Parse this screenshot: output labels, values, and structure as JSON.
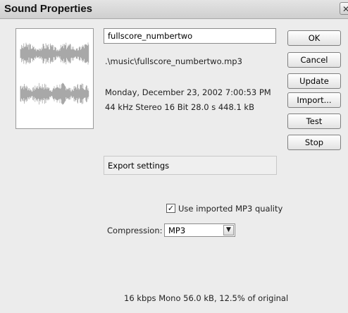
{
  "window": {
    "title": "Sound Properties",
    "close_glyph": "✕"
  },
  "sound": {
    "name": "fullscore_numbertwo",
    "path": ".\\music\\fullscore_numbertwo.mp3",
    "date": "Monday, December 23, 2002  7:00:53 PM",
    "format_info": "44 kHz Stereo 16 Bit 28.0 s 448.1 kB"
  },
  "buttons": {
    "ok": "OK",
    "cancel": "Cancel",
    "update": "Update",
    "import": "Import...",
    "test": "Test",
    "stop": "Stop"
  },
  "export": {
    "section_label": "Export settings",
    "use_mp3_quality_label": "Use imported MP3 quality",
    "use_mp3_quality_checked": true,
    "compression_label": "Compression:",
    "compression_value": "MP3",
    "summary": "16 kbps Mono 56.0 kB, 12.5% of original"
  },
  "icons": {
    "waveform": "waveform-icon",
    "close": "close-icon",
    "dropdown": "chevron-down-icon",
    "check": "check-icon"
  },
  "colors": {
    "waveform": "#a8a8a8",
    "dialog_bg": "#ececec",
    "titlebar_bg": "#d9d9d9"
  }
}
